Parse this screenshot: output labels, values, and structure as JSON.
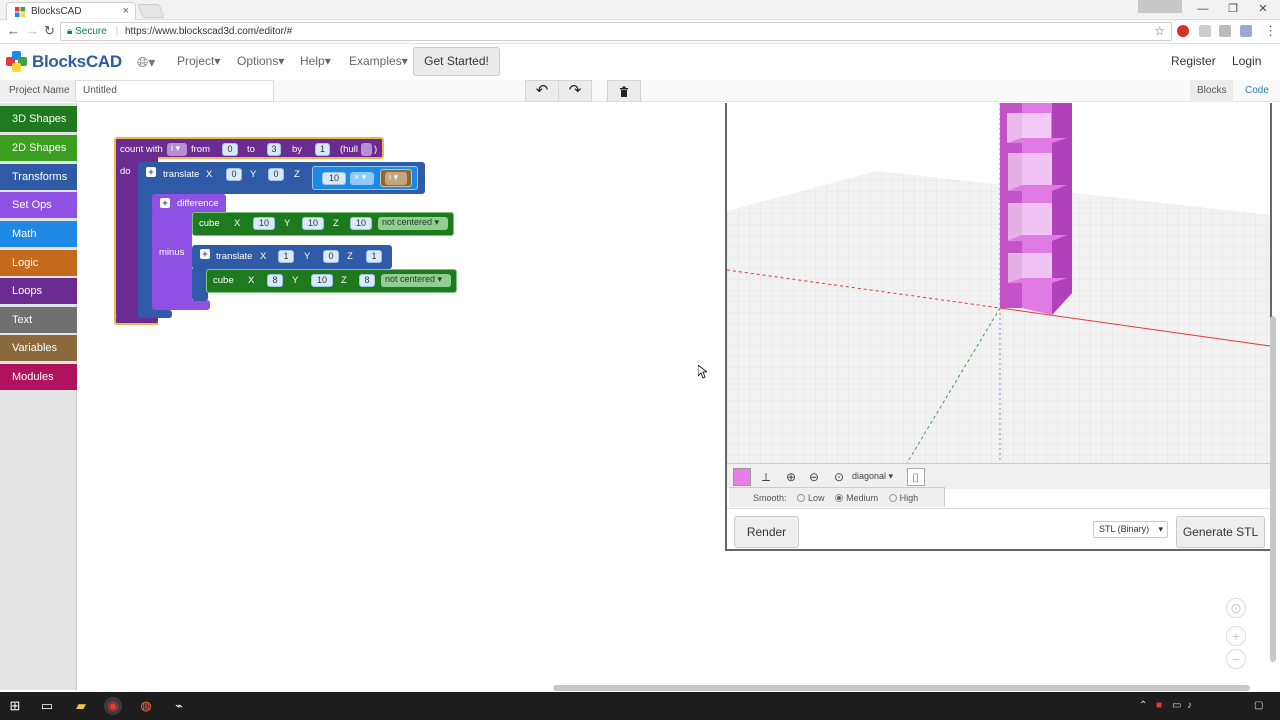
{
  "browser": {
    "tab_title": "BlocksCAD",
    "tab_close": "×",
    "secure_label": "Secure",
    "url": "https://www.blockscad3d.com/editor/#",
    "win_min": "—",
    "win_max": "❐",
    "win_close": "✕"
  },
  "header": {
    "brand": "BlocksCAD",
    "menus": [
      "Project",
      "Options",
      "Help",
      "Examples"
    ],
    "get_started": "Get Started!",
    "register": "Register",
    "login": "Login"
  },
  "toolbar": {
    "project_name_label": "Project Name",
    "project_name_value": "Untitled",
    "undo_icon": "↶",
    "redo_icon": "↷",
    "trash_icon": "🗑",
    "view_tabs": [
      "Blocks",
      "Code"
    ]
  },
  "categories": [
    {
      "label": "3D Shapes",
      "color": "#1f7a1f"
    },
    {
      "label": "2D Shapes",
      "color": "#3c9e1e"
    },
    {
      "label": "Transforms",
      "color": "#2f5ba6"
    },
    {
      "label": "Set Ops",
      "color": "#8e51e4"
    },
    {
      "label": "Math",
      "color": "#1e88e5"
    },
    {
      "label": "Logic",
      "color": "#c46a1c"
    },
    {
      "label": "Loops",
      "color": "#6b2c91"
    },
    {
      "label": "Text",
      "color": "#707070"
    },
    {
      "label": "Variables",
      "color": "#8a6a3c"
    },
    {
      "label": "Modules",
      "color": "#b0125e"
    }
  ],
  "blocks": {
    "loop": {
      "count_with": "count with",
      "var": "i ▾",
      "from": "from",
      "from_val": "0",
      "to": "to",
      "to_val": "3",
      "by": "by",
      "by_val": "1",
      "hull": "(hull",
      "hull_close": ")",
      "do": "do"
    },
    "translate1": {
      "label": "translate",
      "x": "X",
      "x_val": "0",
      "y": "Y",
      "y_val": "0",
      "z": "Z",
      "z_val": "10",
      "op": "× ▾",
      "var": "i ▾"
    },
    "difference": {
      "label": "difference",
      "minus": "minus"
    },
    "cube1": {
      "label": "cube",
      "x": "X",
      "x_val": "10",
      "y": "Y",
      "y_val": "10",
      "z": "Z",
      "z_val": "10",
      "center": "not centered ▾"
    },
    "translate2": {
      "label": "translate",
      "x": "X",
      "x_val": "1",
      "y": "Y",
      "y_val": "0",
      "z": "Z",
      "z_val": "1"
    },
    "cube2": {
      "label": "cube",
      "x": "X",
      "x_val": "8",
      "y": "Y",
      "y_val": "10",
      "z": "Z",
      "z_val": "8",
      "center": "not centered ▾"
    }
  },
  "viewer": {
    "camera_view": "diagonal ▾",
    "smooth_label": "Smooth:",
    "smooth_options": [
      "Low",
      "Medium",
      "High"
    ],
    "smooth_selected": "Medium",
    "render": "Render",
    "format": "STL (Binary)",
    "format_caret": "▾",
    "generate": "Generate STL",
    "model_color": "#d86fe0"
  }
}
